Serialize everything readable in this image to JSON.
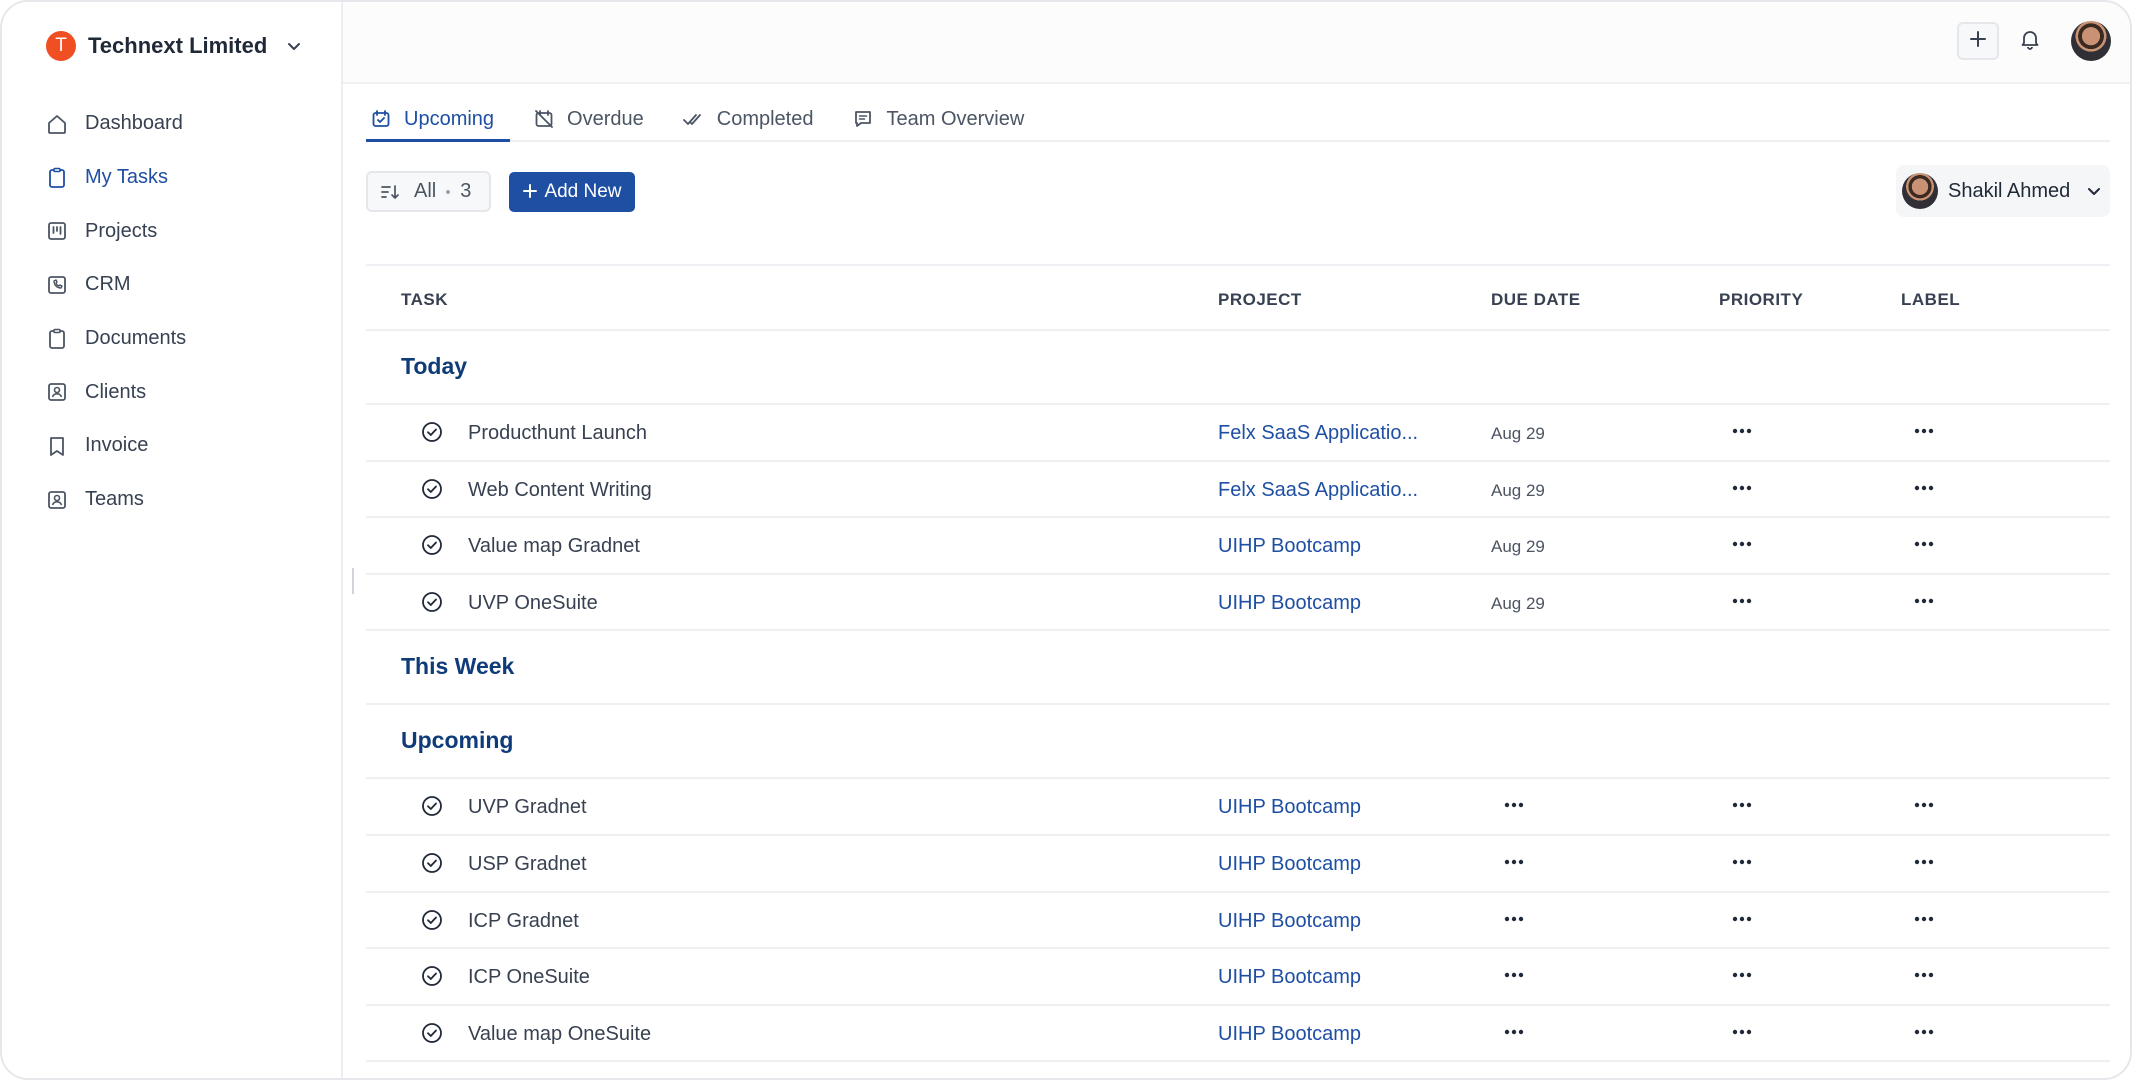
{
  "sidebar": {
    "org_initial": "T",
    "org_name": "Technext Limited",
    "items": [
      {
        "label": "Dashboard",
        "icon": "home-icon"
      },
      {
        "label": "My Tasks",
        "icon": "clipboard-icon"
      },
      {
        "label": "Projects",
        "icon": "kanban-icon"
      },
      {
        "label": "CRM",
        "icon": "phone-icon"
      },
      {
        "label": "Documents",
        "icon": "document-icon"
      },
      {
        "label": "Clients",
        "icon": "contact-icon"
      },
      {
        "label": "Invoice",
        "icon": "bookmark-icon"
      },
      {
        "label": "Teams",
        "icon": "team-icon"
      }
    ],
    "active_item": "My Tasks"
  },
  "tabs": [
    {
      "label": "Upcoming",
      "icon": "calendar-check-icon"
    },
    {
      "label": "Overdue",
      "icon": "calendar-off-icon"
    },
    {
      "label": "Completed",
      "icon": "double-check-icon"
    },
    {
      "label": "Team Overview",
      "icon": "message-icon"
    }
  ],
  "active_tab": "Upcoming",
  "toolbar": {
    "filter_label": "All",
    "filter_count": "3",
    "add_new_label": "Add New",
    "user_name": "Shakil Ahmed"
  },
  "table": {
    "columns": {
      "task": "TASK",
      "project": "PROJECT",
      "due_date": "DUE DATE",
      "priority": "PRIORITY",
      "label": "LABEL"
    },
    "groups": {
      "today": {
        "title": "Today",
        "rows": [
          {
            "task": "Producthunt Launch",
            "project": "Felx SaaS Applicatio...",
            "due": "Aug 29"
          },
          {
            "task": "Web Content Writing",
            "project": "Felx SaaS Applicatio...",
            "due": "Aug 29"
          },
          {
            "task": "Value map Gradnet",
            "project": "UIHP Bootcamp",
            "due": "Aug 29"
          },
          {
            "task": "UVP OneSuite",
            "project": "UIHP Bootcamp",
            "due": "Aug 29"
          }
        ]
      },
      "this_week": {
        "title": "This Week",
        "rows": []
      },
      "upcoming": {
        "title": "Upcoming",
        "rows": [
          {
            "task": "UVP Gradnet",
            "project": "UIHP Bootcamp",
            "due": null
          },
          {
            "task": "USP Gradnet",
            "project": "UIHP Bootcamp",
            "due": null
          },
          {
            "task": "ICP Gradnet",
            "project": "UIHP Bootcamp",
            "due": null
          },
          {
            "task": "ICP OneSuite",
            "project": "UIHP Bootcamp",
            "due": null
          },
          {
            "task": "Value map OneSuite",
            "project": "UIHP Bootcamp",
            "due": null
          }
        ]
      }
    }
  },
  "colors": {
    "accent": "#1e4fa3",
    "group_title": "#0f3b78",
    "org_logo": "#f04e23"
  }
}
